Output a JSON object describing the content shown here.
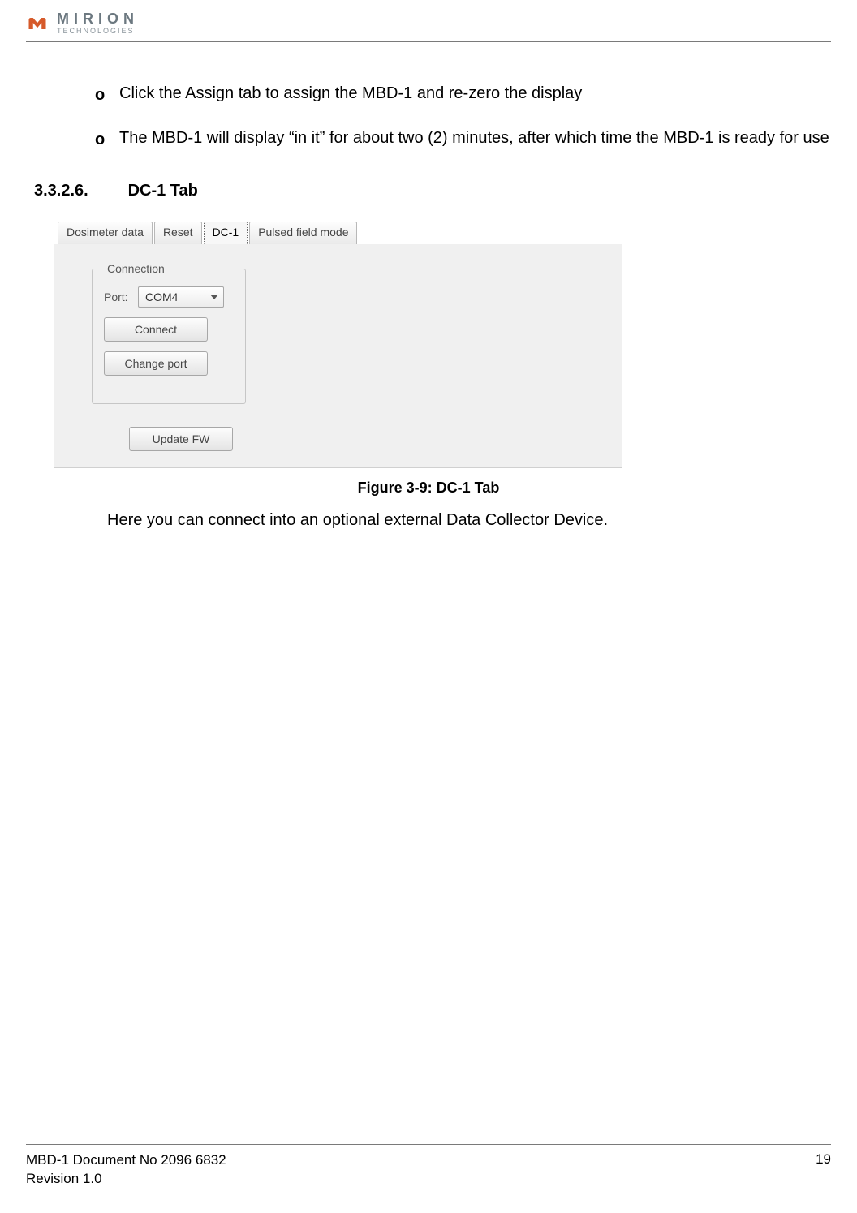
{
  "logo": {
    "name": "MIRION",
    "sub": "TECHNOLOGIES"
  },
  "bullets": [
    "Click the Assign tab to assign the MBD-1 and re-zero the display",
    "The MBD-1 will display “in it” for about two (2) minutes, after which time the MBD-1 is ready for use"
  ],
  "section": {
    "number": "3.3.2.6.",
    "title": "DC-1 Tab"
  },
  "shot": {
    "tabs": [
      "Dosimeter data",
      "Reset",
      "DC-1",
      "Pulsed field mode"
    ],
    "active_tab_index": 2,
    "group_label": "Connection",
    "port_label": "Port:",
    "port_value": "COM4",
    "connect_btn": "Connect",
    "change_port_btn": "Change port",
    "update_fw_btn": "Update FW"
  },
  "caption": "Figure 3-9: DC-1 Tab",
  "paragraph": "Here you can connect into an optional external Data Collector Device.",
  "footer": {
    "doc": "MBD-1 Document No 2096 6832",
    "rev": "Revision 1.0",
    "page": "19"
  }
}
